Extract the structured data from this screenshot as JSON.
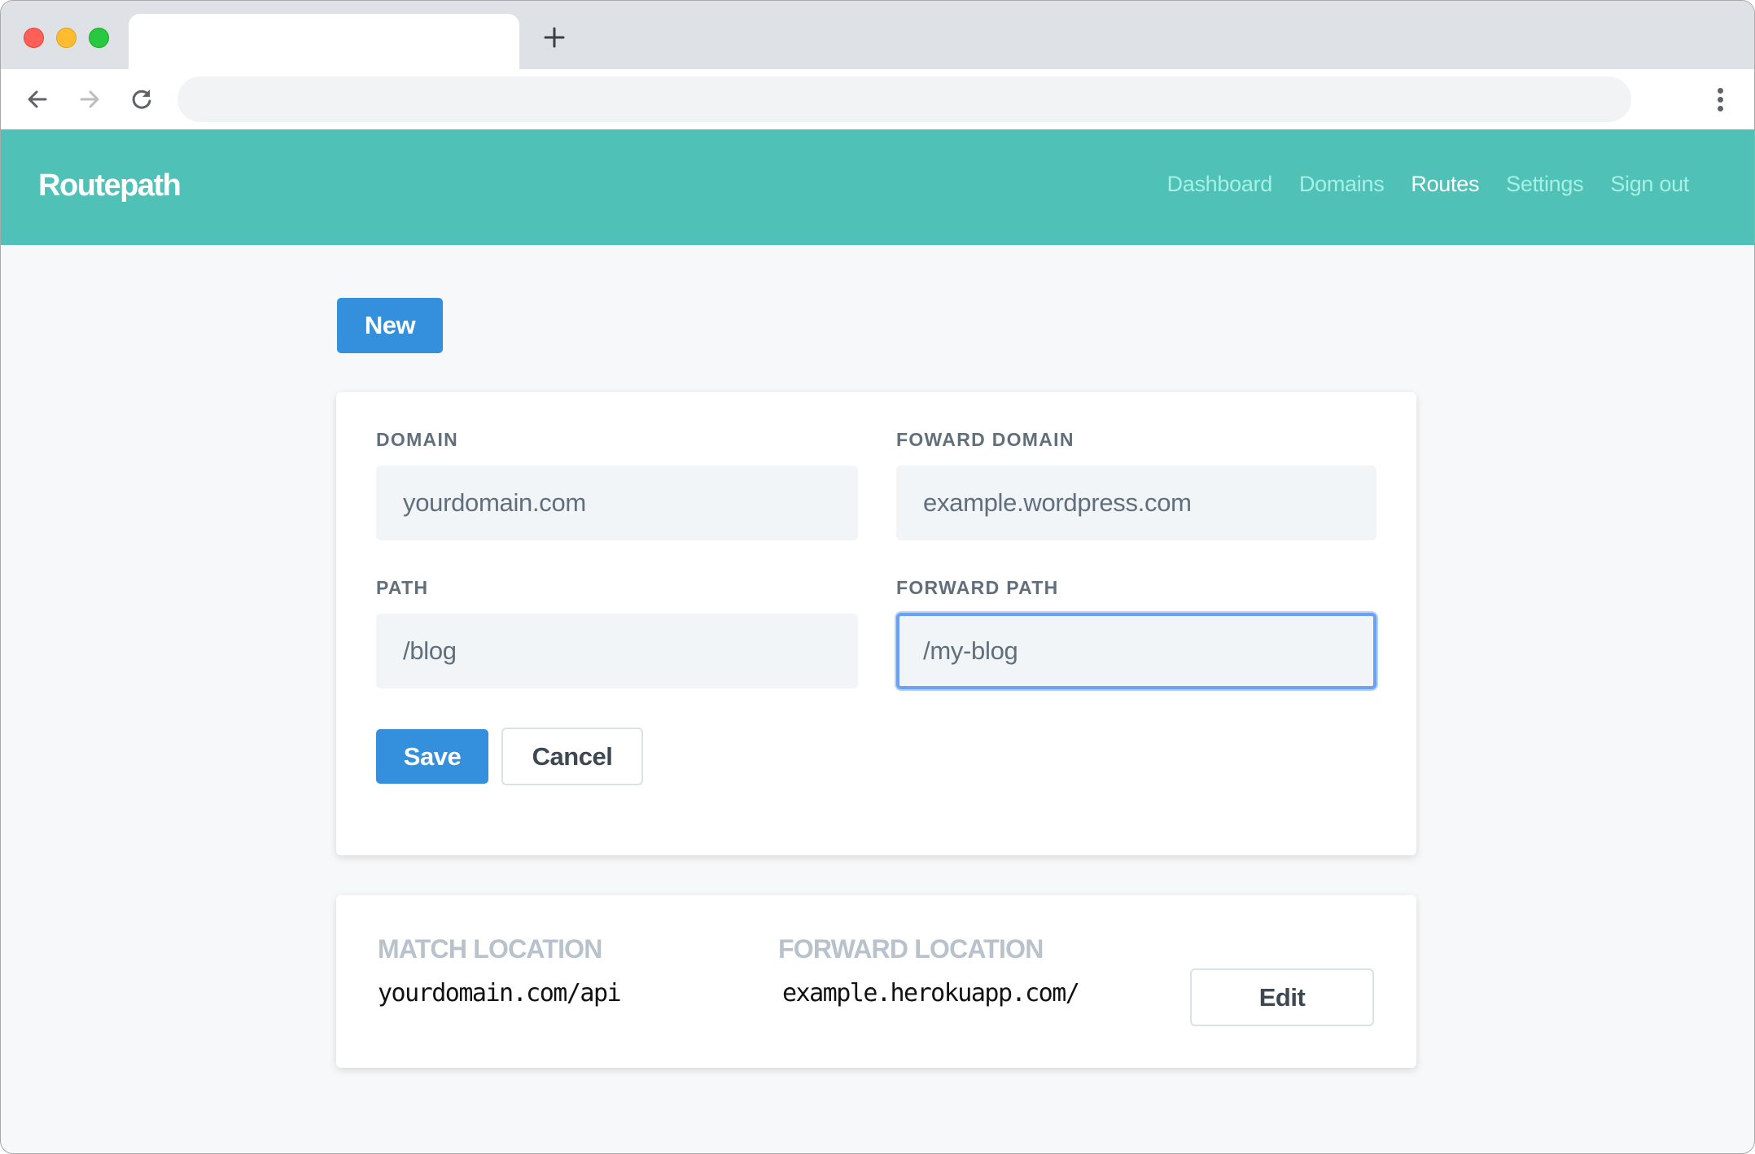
{
  "browser": {
    "tab_title": "",
    "new_tab_icon": "plus-icon",
    "back_icon": "arrow-left-icon",
    "forward_icon": "arrow-right-icon",
    "reload_icon": "reload-icon",
    "address": "",
    "menu_icon": "more-vertical-icon"
  },
  "nav": {
    "brand": "Routepath",
    "links": [
      {
        "label": "Dashboard",
        "active": false
      },
      {
        "label": "Domains",
        "active": false
      },
      {
        "label": "Routes",
        "active": true
      },
      {
        "label": "Settings",
        "active": false
      },
      {
        "label": "Sign out",
        "active": false
      }
    ]
  },
  "actions": {
    "new_label": "New"
  },
  "form": {
    "domain": {
      "label": "DOMAIN",
      "value": "yourdomain.com"
    },
    "forward_domain": {
      "label": "FOWARD DOMAIN",
      "value": "example.wordpress.com"
    },
    "path": {
      "label": "PATH",
      "value": "/blog"
    },
    "forward_path": {
      "label": "FORWARD PATH",
      "value": "/my-blog",
      "focused": true
    },
    "save_label": "Save",
    "cancel_label": "Cancel"
  },
  "routes": [
    {
      "match_label": "MATCH LOCATION",
      "match_value": "yourdomain.com/api",
      "forward_label": "FORWARD LOCATION",
      "forward_value": "example.herokuapp.com/",
      "edit_label": "Edit"
    }
  ],
  "colors": {
    "nav_bg": "#4fc1b6",
    "primary": "#3490dc",
    "focus_ring": "#6aa1f5"
  }
}
